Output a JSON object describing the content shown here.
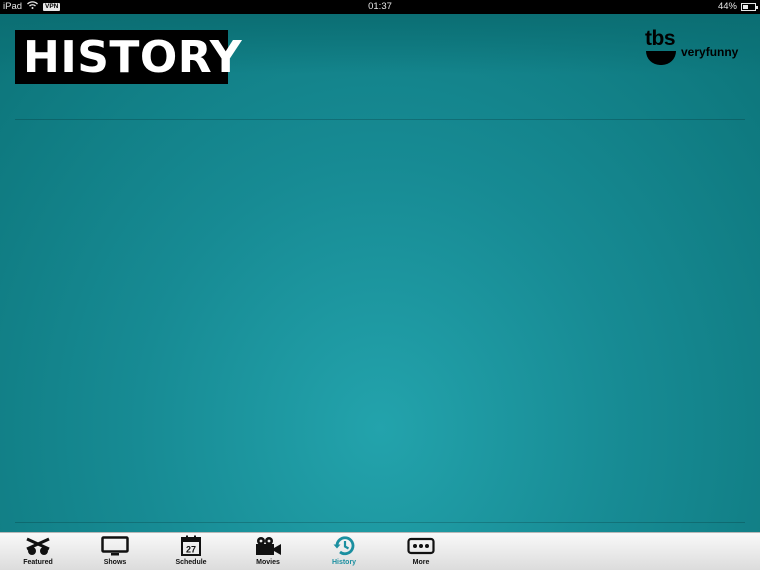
{
  "status_bar": {
    "device": "iPad",
    "vpn_label": "VPN",
    "time": "01:37",
    "battery_percent": "44%",
    "battery_level": 0.44
  },
  "header": {
    "title": "HISTORY",
    "brand": {
      "name": "tbs",
      "tagline": "veryfunny"
    }
  },
  "tabs": [
    {
      "label": "Featured",
      "icon": "featured-icon"
    },
    {
      "label": "Shows",
      "icon": "tv-icon"
    },
    {
      "label": "Schedule",
      "icon": "calendar-icon",
      "icon_text": "27"
    },
    {
      "label": "Movies",
      "icon": "movie-camera-icon"
    },
    {
      "label": "History",
      "icon": "history-clock-icon",
      "active": true
    },
    {
      "label": "More",
      "icon": "more-icon"
    }
  ],
  "colors": {
    "background": "#178b94",
    "active_tab": "#1b8fa0",
    "title_bg": "#000000"
  }
}
